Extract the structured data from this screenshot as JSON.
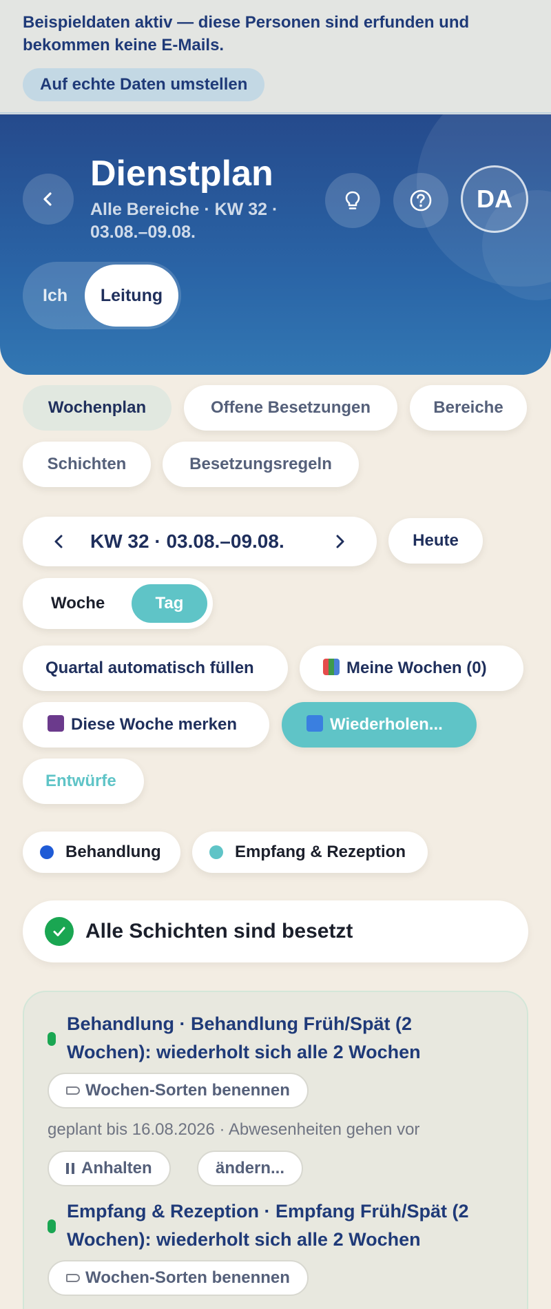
{
  "demo_banner": {
    "text": "Beispieldaten aktiv — diese Personen sind erfunden und bekommen keine E-Mails.",
    "button": "Auf echte Daten umstellen"
  },
  "header": {
    "title": "Dienstplan",
    "subtitle": "Alle Bereiche · KW 32 · 03.08.–09.08.",
    "avatar_initials": "DA",
    "role_ich": "Ich",
    "role_leitung": "Leitung",
    "icons": [
      "back-icon",
      "lightbulb-icon",
      "help-icon"
    ]
  },
  "tabs": [
    "Wochenplan",
    "Offene Besetzungen",
    "Bereiche",
    "Schichten",
    "Besetzungsregeln"
  ],
  "week_nav": {
    "label": "KW 32 · 03.08.–09.08.",
    "today": "Heute",
    "view_week": "Woche",
    "view_day": "Tag"
  },
  "actions": {
    "fill_quarter": "Quartal automatisch füllen",
    "my_weeks": "Meine Wochen (0)",
    "save_week": "Diese Woche merken",
    "repeat": "Wiederholen...",
    "drafts": "Entwürfe"
  },
  "legend": [
    {
      "label": "Behandlung",
      "color": "#1f5bd6"
    },
    {
      "label": "Empfang & Rezeption",
      "color": "#5fc4c7"
    }
  ],
  "status": {
    "text": "Alle Schichten sind besetzt",
    "color": "#1aa652"
  },
  "rules": [
    {
      "title": "Behandlung · Behandlung Früh/Spät (2 Wochen): wiederholt sich alle 2 Wochen",
      "name_button": "Wochen-Sorten benennen",
      "note": "geplant bis 16.08.2026 · Abwesenheiten gehen vor",
      "pause_button": "Anhalten",
      "edit_button": "ändern..."
    },
    {
      "title": "Empfang & Rezeption · Empfang Früh/Spät (2 Wochen): wiederholt sich alle 2 Wochen",
      "name_button": "Wochen-Sorten benennen"
    }
  ]
}
